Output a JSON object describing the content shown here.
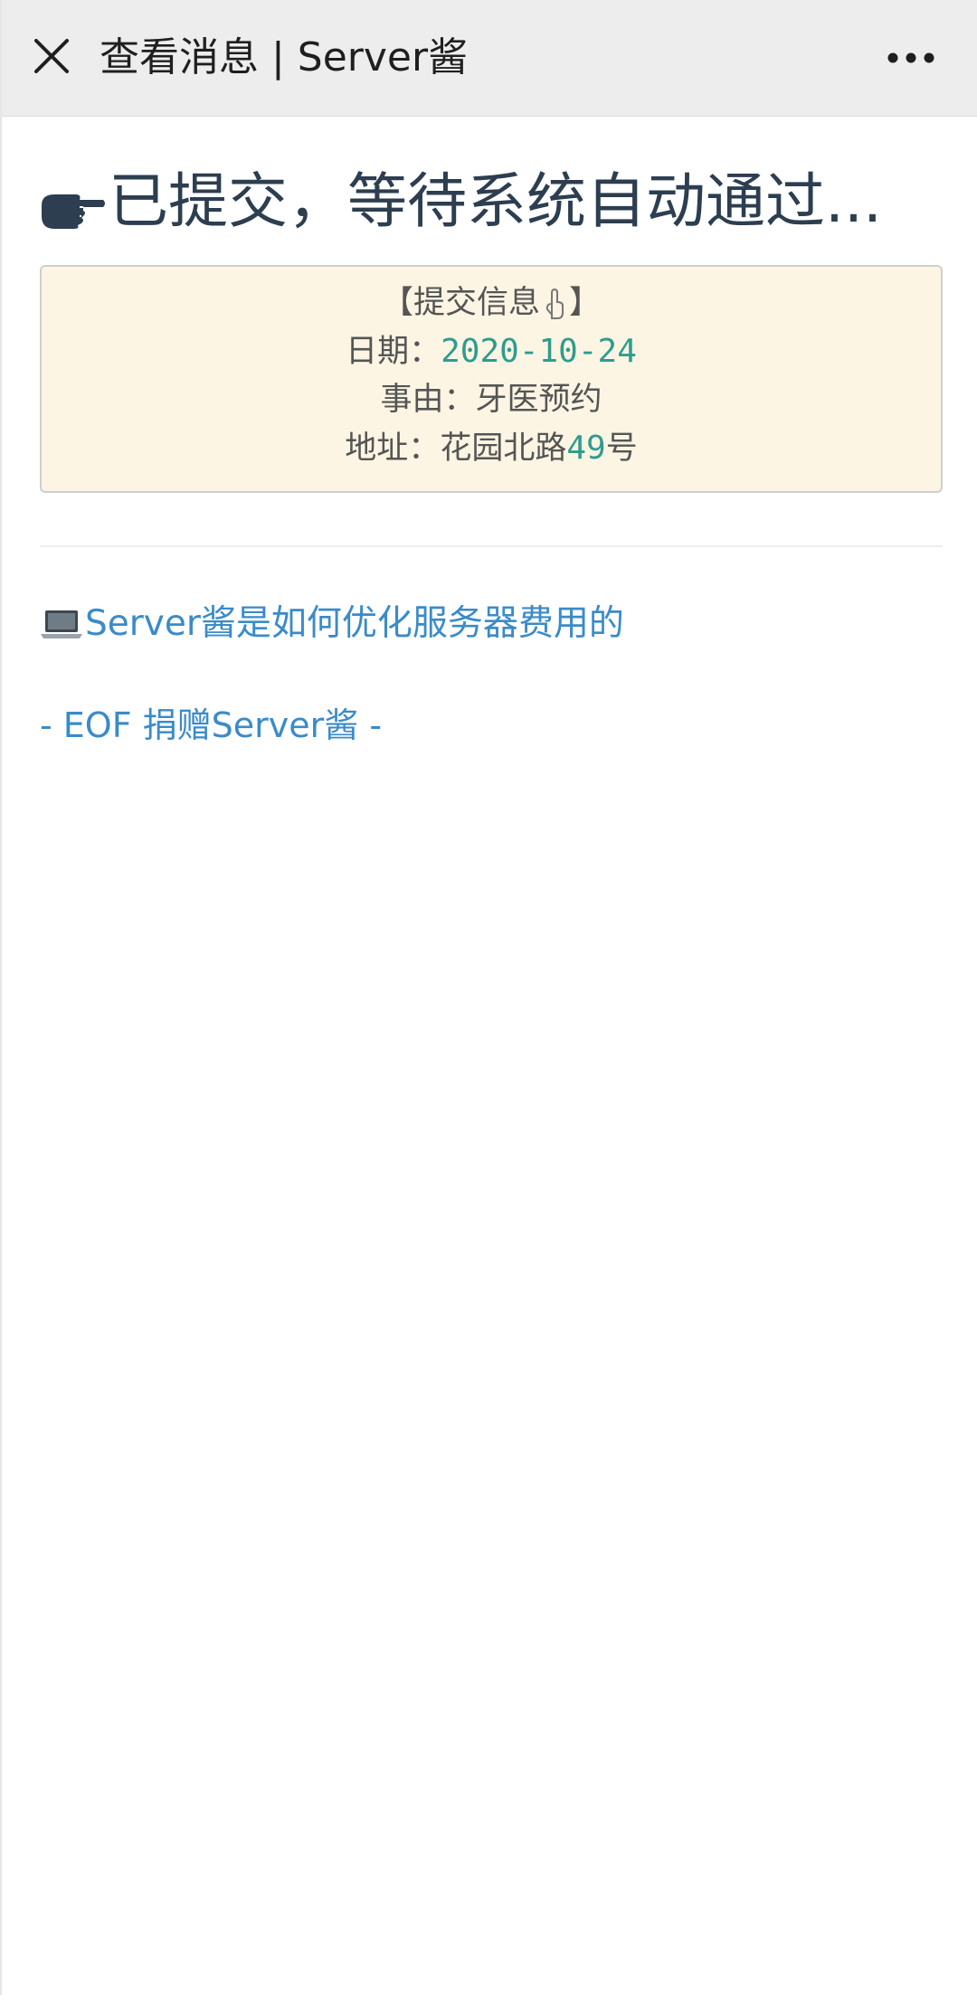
{
  "topbar": {
    "close_icon": "close-icon",
    "title": "查看消息 | Server酱",
    "more_icon": "more-icon"
  },
  "message": {
    "headline": "已提交，等待系统自动通过...",
    "headline_icon": "pointing-hand-icon",
    "info_box": {
      "title_prefix": "【提交信息",
      "title_suffix": "】",
      "title_icon": "pointing-finger-icon",
      "date_label": "日期：",
      "date_value": "2020-10-24",
      "reason_label": "事由：",
      "reason_value": "牙医预约",
      "address_label": "地址：",
      "address_value_prefix": "花园北路",
      "address_value_number": "49",
      "address_value_suffix": "号"
    },
    "link": {
      "icon": "laptop-icon",
      "text": "Server酱是如何优化服务器费用的"
    },
    "eof": "- EOF 捐赠Server酱 -"
  },
  "colors": {
    "topbar_bg": "#ededed",
    "headline": "#2c3e50",
    "info_bg": "#fcf5e3",
    "teal": "#2e9c8f",
    "link": "#3a8bc9"
  }
}
